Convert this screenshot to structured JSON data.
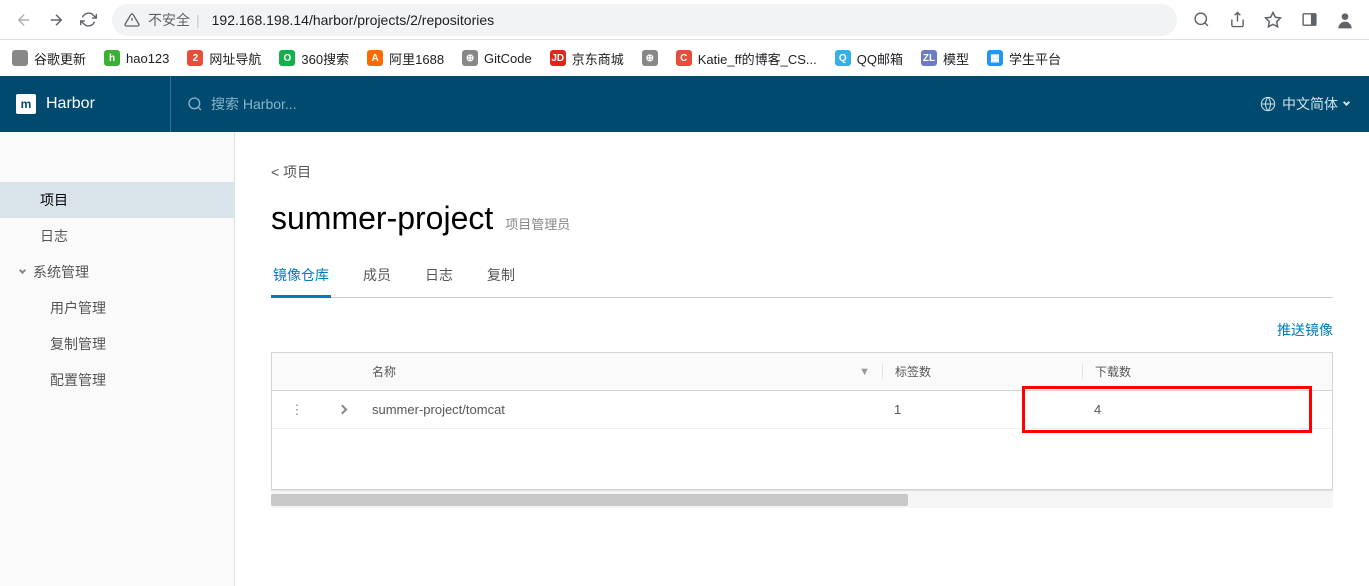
{
  "browser": {
    "url_prefix": "不安全",
    "url": "192.168.198.14/harbor/projects/2/repositories"
  },
  "bookmarks": [
    {
      "label": "谷歌更新",
      "color": "#888",
      "glyph": ""
    },
    {
      "label": "hao123",
      "color": "#3cb034",
      "glyph": "h"
    },
    {
      "label": "网址导航",
      "color": "#e94e3c",
      "glyph": "2"
    },
    {
      "label": "360搜索",
      "color": "#13b04b",
      "glyph": "O"
    },
    {
      "label": "阿里1688",
      "color": "#ff6a00",
      "glyph": "A"
    },
    {
      "label": "GitCode",
      "color": "#888",
      "glyph": "⊕"
    },
    {
      "label": "京东商城",
      "color": "#e1251b",
      "glyph": "JD"
    },
    {
      "label": "",
      "color": "#888",
      "glyph": "⊕"
    },
    {
      "label": "Katie_ff的博客_CS...",
      "color": "#e74c3c",
      "glyph": "C"
    },
    {
      "label": "QQ邮箱",
      "color": "#34b0e9",
      "glyph": "Q"
    },
    {
      "label": "模型",
      "color": "#6b7bc5",
      "glyph": "ZL"
    },
    {
      "label": "学生平台",
      "color": "#2196f3",
      "glyph": "▦"
    }
  ],
  "header": {
    "app_name": "Harbor",
    "search_placeholder": "搜索 Harbor...",
    "language": "中文简体"
  },
  "sidebar": {
    "items": [
      {
        "label": "项目",
        "active": true
      },
      {
        "label": "日志",
        "active": false
      }
    ],
    "admin_group": "系统管理",
    "admin_items": [
      {
        "label": "用户管理"
      },
      {
        "label": "复制管理"
      },
      {
        "label": "配置管理"
      }
    ]
  },
  "content": {
    "breadcrumb": "< 项目",
    "title": "summer-project",
    "role": "项目管理员",
    "tabs": [
      {
        "label": "镜像仓库",
        "active": true
      },
      {
        "label": "成员",
        "active": false
      },
      {
        "label": "日志",
        "active": false
      },
      {
        "label": "复制",
        "active": false
      }
    ],
    "push_link": "推送镜像",
    "table": {
      "columns": {
        "name": "名称",
        "tags": "标签数",
        "downloads": "下载数"
      },
      "rows": [
        {
          "name": "summer-project/tomcat",
          "tags": "1",
          "downloads": "4"
        }
      ]
    }
  }
}
